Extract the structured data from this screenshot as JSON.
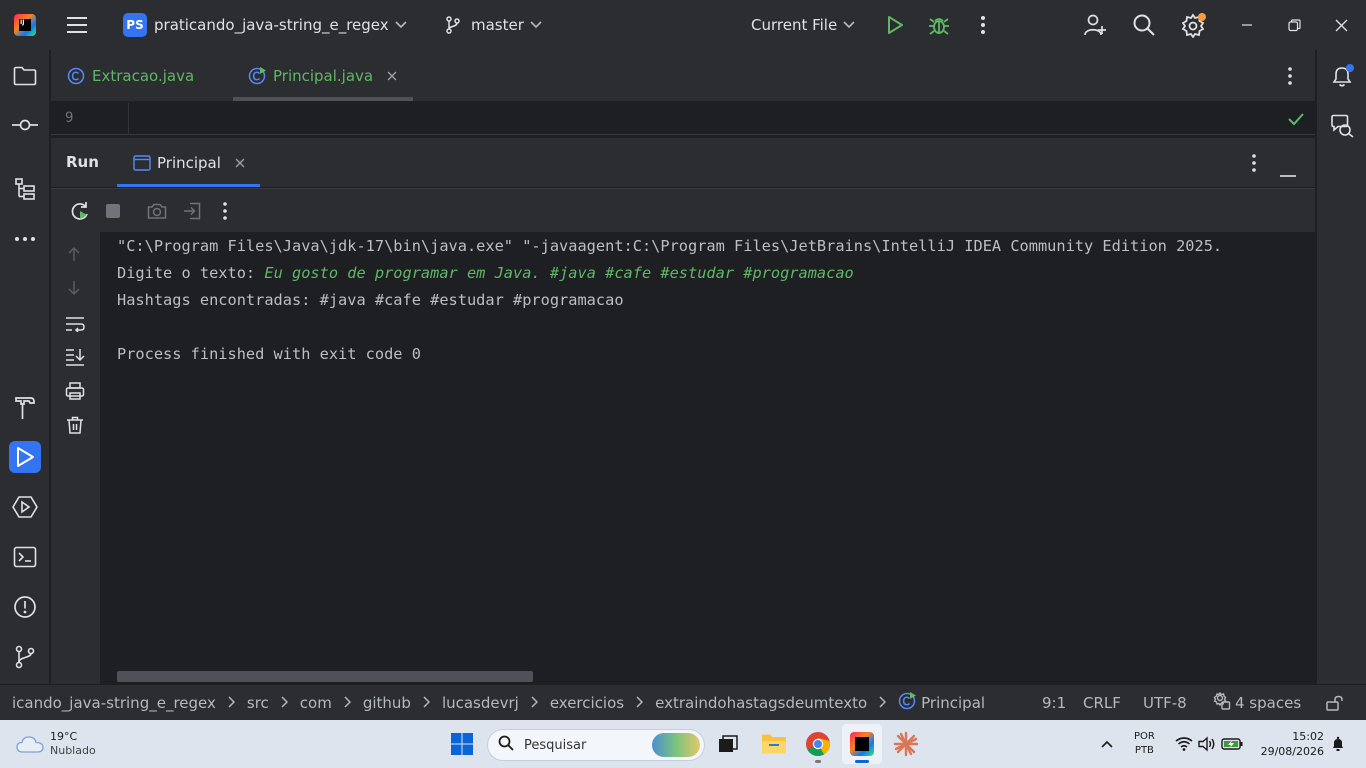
{
  "titlebar": {
    "project_badge": "PS",
    "project_name": "praticando_java-string_e_regex",
    "branch": "master",
    "run_config": "Current File"
  },
  "editor_tabs": [
    {
      "label": "Extracao.java",
      "active": false
    },
    {
      "label": "Principal.java",
      "active": true
    }
  ],
  "editor": {
    "line_number": "9"
  },
  "run_panel": {
    "title": "Run",
    "tab_label": "Principal",
    "console": {
      "command": "\"C:\\Program Files\\Java\\jdk-17\\bin\\java.exe\" \"-javaagent:C:\\Program Files\\JetBrains\\IntelliJ IDEA Community Edition 2025.",
      "prompt": "Digite o texto: ",
      "user_input": "Eu gosto de programar em Java. #java #cafe #estudar #programacao",
      "result": "Hashtags encontradas: #java #cafe #estudar #programacao",
      "exit": "Process finished with exit code 0"
    }
  },
  "statusbar": {
    "breadcrumbs": [
      "icando_java-string_e_regex",
      "src",
      "com",
      "github",
      "lucasdevrj",
      "exercicios",
      "extraindohastagsdeumtexto",
      "Principal"
    ],
    "position": "9:1",
    "line_ending": "CRLF",
    "encoding": "UTF-8",
    "indent": "4 spaces"
  },
  "taskbar": {
    "weather_temp": "19°C",
    "weather_desc": "Nublado",
    "search_placeholder": "Pesquisar",
    "lang_line1": "POR",
    "lang_line2": "PTB",
    "time": "15:02",
    "date": "29/08/2026"
  },
  "colors": {
    "accent": "#3574f0",
    "run_green": "#5fb865",
    "notification": "#fc9b3c"
  }
}
